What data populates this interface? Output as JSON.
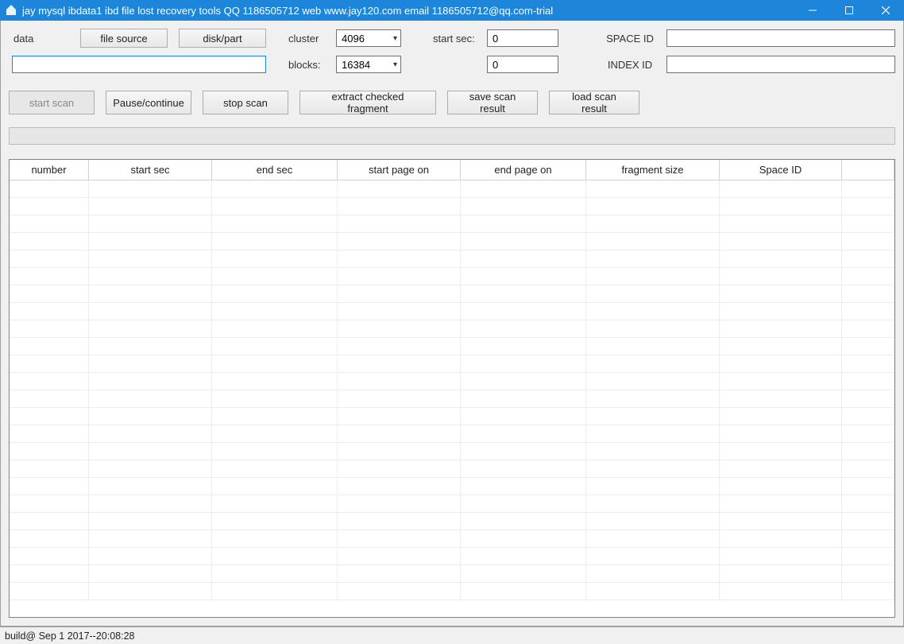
{
  "window": {
    "title": "jay mysql ibdata1 ibd file lost recovery tools  QQ 1186505712 web www.jay120.com email 1186505712@qq.com-trial"
  },
  "topPanel": {
    "data_label": "data",
    "file_source_label": "file source",
    "disk_part_label": "disk/part",
    "cluster_label": "cluster",
    "cluster_value": "4096",
    "blocks_label": "blocks:",
    "blocks_value": "16384",
    "start_sec_label": "start sec:",
    "start_sec_value": "0",
    "start_sec2_value": "0",
    "space_id_label": "SPACE ID",
    "space_id_value": "",
    "index_id_label": "INDEX ID",
    "index_id_value": "",
    "data_path_value": ""
  },
  "toolbar": {
    "start_scan": "start scan",
    "pause_continue": "Pause/continue",
    "stop_scan": "stop scan",
    "extract_checked": "extract checked fragment",
    "save_result": "save scan result",
    "load_result": "load scan result"
  },
  "table": {
    "headers": {
      "number": "number",
      "start_sec": "start sec",
      "end_sec": "end  sec",
      "start_page_on": "start page on",
      "end_page_on": "end   page on",
      "fragment_size": "fragment size",
      "space_id": "Space ID"
    }
  },
  "statusbar": {
    "text": "build@ Sep  1 2017--20:08:28"
  }
}
